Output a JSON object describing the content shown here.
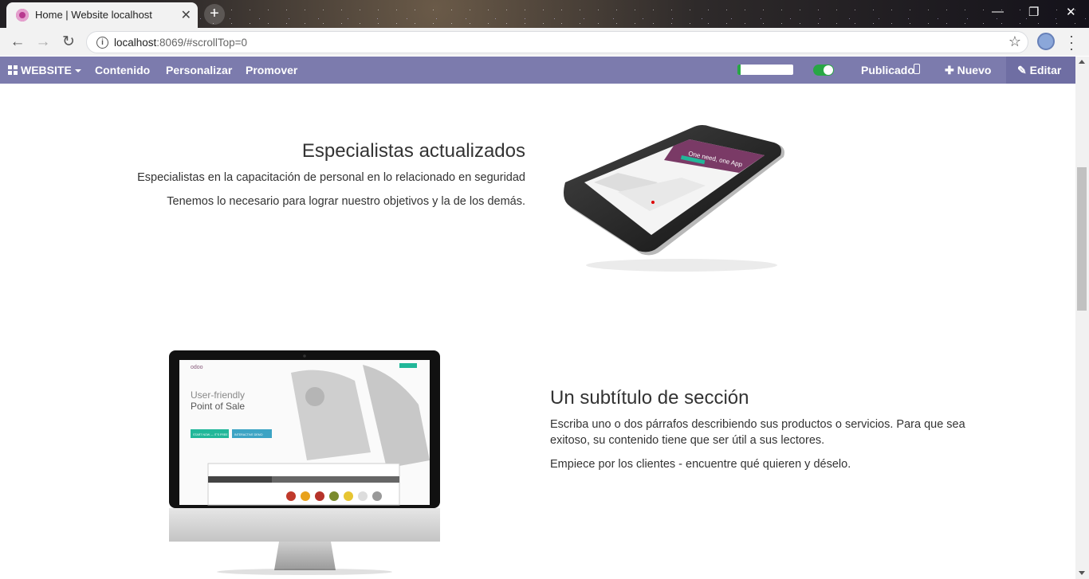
{
  "browser": {
    "tab_title": "Home | Website localhost",
    "tab_close": "✕",
    "new_tab": "+",
    "url_host": "localhost",
    "url_rest": ":8069/#scrollTop=0",
    "window_controls": [
      "—",
      "❐",
      "✕"
    ]
  },
  "editbar": {
    "website_menu": "WEBSITE",
    "content": "Contenido",
    "customize": "Personalizar",
    "promote": "Promover",
    "seo_progress": 0.05,
    "published_label": "Publicado",
    "new_label": "Nuevo",
    "edit_label": "Editar",
    "colors": {
      "bar": "#7c7bad",
      "toggle_on": "#28a745"
    }
  },
  "section1": {
    "title": "Especialistas actualizados",
    "paragraph1": "Especialistas en la capacitación de personal en lo relacionado en seguridad",
    "paragraph2": "Tenemos lo necesario para lograr nuestro objetivos y la de los demás."
  },
  "section2": {
    "title": "Un subtítulo de sección",
    "paragraph1": "Escriba uno o dos párrafos describiendo sus productos o servicios. Para que sea exitoso, su contenido tiene que ser útil a sus lectores.",
    "paragraph2": "Empiece por los clientes - encuentre qué quieren y déselo."
  },
  "tablet_screen": {
    "headline": "One need, one App"
  },
  "imac_screen": {
    "brand": "odoo",
    "headline_line1": "User-friendly",
    "headline_line2": "Point of Sale",
    "cta_primary": "START NOW — IT'S FREE",
    "cta_secondary": "INTERACTIVE DEMO"
  }
}
